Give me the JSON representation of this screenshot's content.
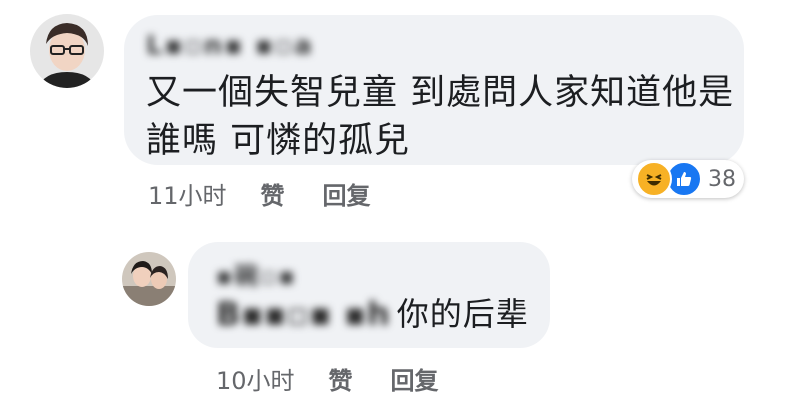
{
  "comment1": {
    "author": "L▪▫n▪ ▪▫a",
    "text_line1": "又一個失智兒童 到處問人家知道他是",
    "text_line2": "誰嗎 可憐的孤兒",
    "time": "11小时",
    "like_label": "赞",
    "reply_label": "回复",
    "reactions": {
      "icons": [
        "haha-icon",
        "like-icon"
      ],
      "count": "38"
    }
  },
  "reply1": {
    "author": "▪碗▫▪",
    "mention": "B▪▪▫▪ ▪h",
    "text": "你的后辈",
    "time": "10小时",
    "like_label": "赞",
    "reply_label": "回复"
  },
  "colors": {
    "bubble": "#f0f2f5",
    "meta_text": "#65676b",
    "like_blue": "#1877f2",
    "haha_yellow": "#f7b125"
  }
}
